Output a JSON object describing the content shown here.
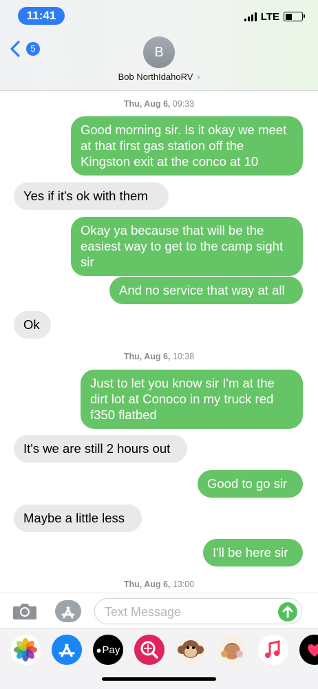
{
  "status_bar": {
    "time": "11:41",
    "network": "LTE"
  },
  "nav": {
    "back_count": "5",
    "avatar_letter": "B",
    "contact_name": "Bob NorthIdahoRV",
    "contact_chevron": "›"
  },
  "conversation": {
    "stamps": [
      {
        "day": "Thu, Aug 6,",
        "time": "09:33"
      },
      {
        "day": "Thu, Aug 6,",
        "time": "10:38"
      },
      {
        "day": "Thu, Aug 6,",
        "time": "13:00"
      }
    ],
    "messages": [
      {
        "direction": "outgoing",
        "text": "Good morning sir. Is it okay we meet at that first gas station off the Kingston exit at the conco at 10"
      },
      {
        "direction": "incoming",
        "text": "Yes if it's ok with them"
      },
      {
        "direction": "outgoing",
        "text": "Okay ya because that will be the easiest way to get to the camp sight sir"
      },
      {
        "direction": "outgoing",
        "text": "And no service that way at all"
      },
      {
        "direction": "incoming",
        "text": "Ok"
      },
      {
        "direction": "outgoing",
        "text": "Just to let you know sir I'm at the dirt lot  at Conoco  in my truck red f350 flatbed"
      },
      {
        "direction": "incoming",
        "text": "It's we are still 2 hours out"
      },
      {
        "direction": "outgoing",
        "text": "Good to go sir"
      },
      {
        "direction": "incoming",
        "text": "Maybe a little less"
      },
      {
        "direction": "outgoing",
        "text": "I'll be here sir"
      }
    ]
  },
  "composer": {
    "placeholder": "Text Message"
  },
  "app_drawer": {
    "apps": [
      {
        "name": "photos",
        "icon": "photos-icon"
      },
      {
        "name": "app-store",
        "icon": "app-store-icon"
      },
      {
        "name": "apple-pay",
        "icon": "apple-pay-icon",
        "label": "Pay"
      },
      {
        "name": "images-search",
        "icon": "globe-search-icon"
      },
      {
        "name": "animoji",
        "icon": "monkey-animoji-icon"
      },
      {
        "name": "memoji",
        "icon": "memoji-icon"
      },
      {
        "name": "music",
        "icon": "music-note-icon"
      },
      {
        "name": "digital-touch",
        "icon": "heart-icon"
      }
    ]
  },
  "colors": {
    "outgoing_bubble": "#65c466",
    "incoming_bubble": "#e9e9eb",
    "accent_blue": "#2f7df6",
    "timestamp_gray": "#8e8e93"
  }
}
